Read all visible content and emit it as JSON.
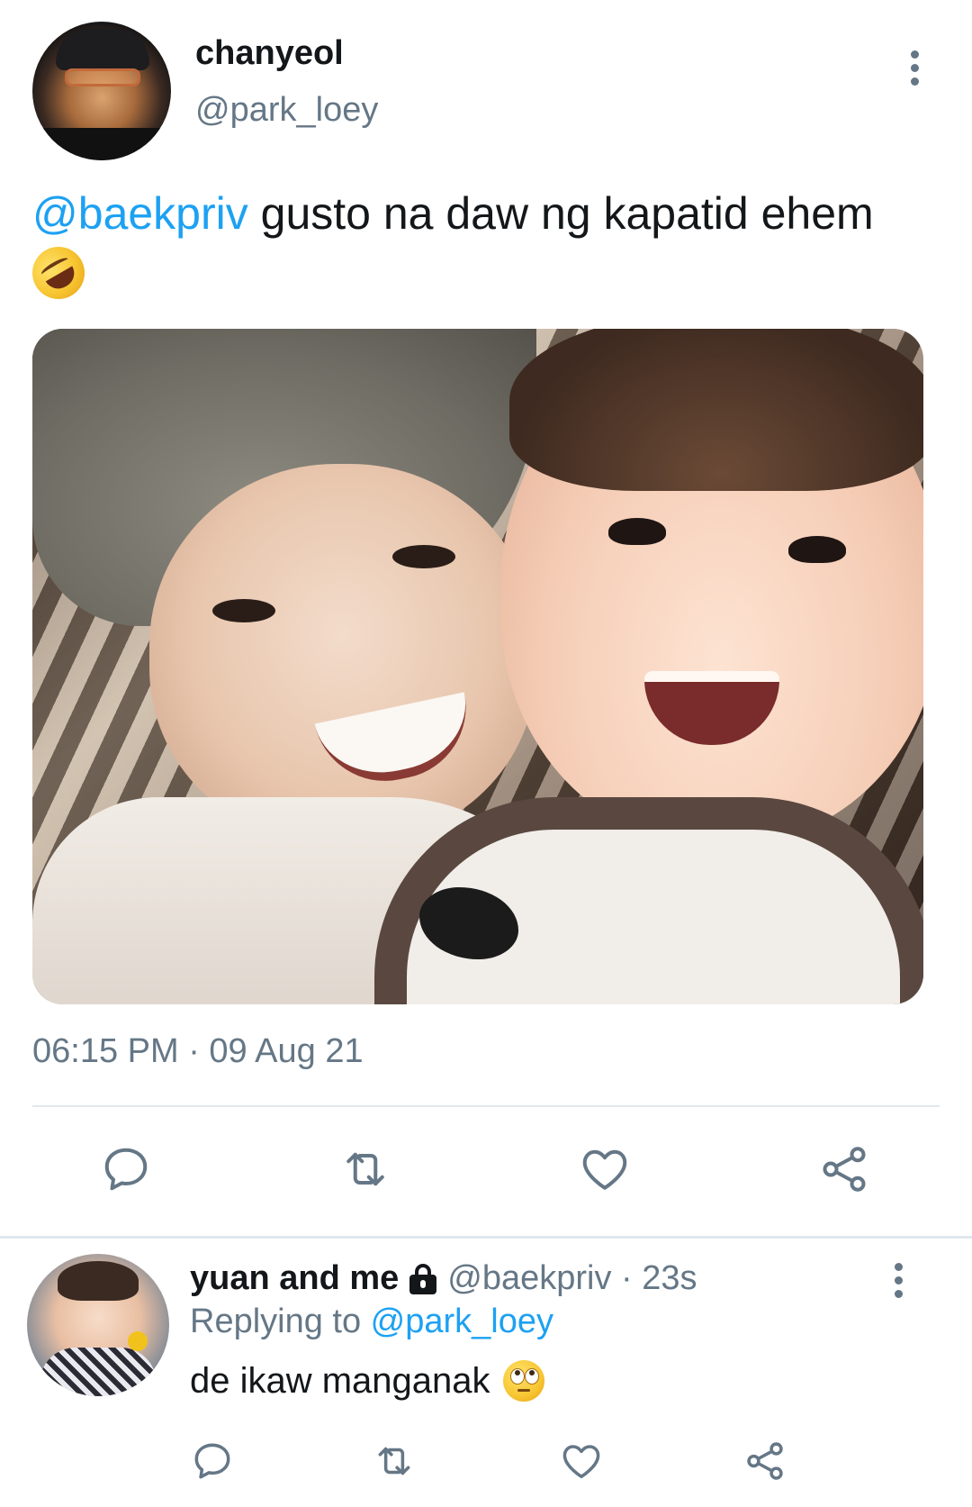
{
  "tweet": {
    "author": {
      "display_name": "chanyeol",
      "handle": "@park_loey"
    },
    "text": {
      "mention": "@baekpriv",
      "body": " gusto na daw ng kapatid ehem",
      "emoji": "rolling-on-the-floor-laughing"
    },
    "timestamp": "06:15 PM · 09 Aug 21",
    "actions": [
      "reply-icon",
      "retweet-icon",
      "like-icon",
      "share-icon"
    ]
  },
  "reply": {
    "author": {
      "display_name": "yuan and me",
      "protected_icon": "lock-icon",
      "meta": "@baekpriv · 23s"
    },
    "replying_to_label": "Replying to ",
    "replying_to_handle": "@park_loey",
    "text": "de ikaw manganak",
    "emoji": "face-with-rolling-eyes",
    "actions": [
      "reply-icon",
      "retweet-icon",
      "like-icon",
      "share-icon"
    ]
  },
  "colors": {
    "text": "#14171a",
    "secondary": "#657786",
    "link": "#1da1f2",
    "divider": "#e1e8ed"
  }
}
